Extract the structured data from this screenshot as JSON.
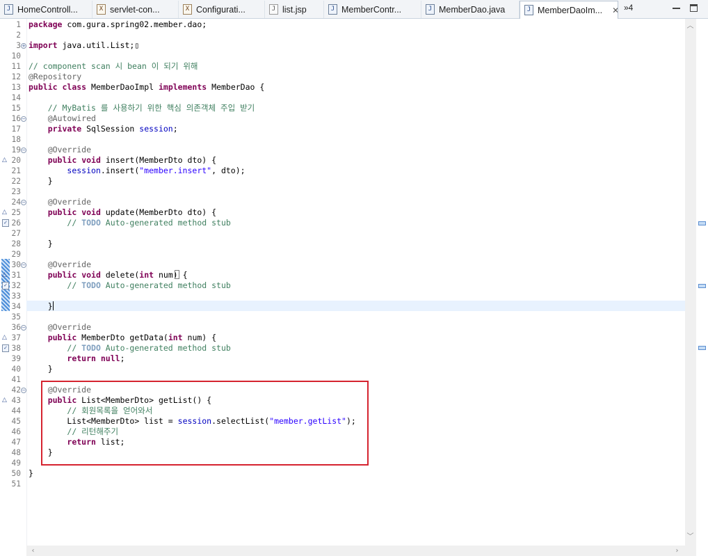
{
  "tabs": [
    {
      "label": "HomeControll...",
      "icon": "java-file-icon",
      "glyph": "J"
    },
    {
      "label": "servlet-con...",
      "icon": "xml-file-icon",
      "glyph": "X"
    },
    {
      "label": "Configurati...",
      "icon": "xml-file-icon",
      "glyph": "X"
    },
    {
      "label": "list.jsp",
      "icon": "jsp-file-icon",
      "glyph": "J"
    },
    {
      "label": "MemberContr...",
      "icon": "java-file-icon",
      "glyph": "J"
    },
    {
      "label": "MemberDao.java",
      "icon": "java-file-icon",
      "glyph": "J"
    },
    {
      "label": "MemberDaoIm...",
      "icon": "java-file-icon",
      "glyph": "J",
      "active": true,
      "close": "✕"
    }
  ],
  "tab_overflow": "»4",
  "editor": {
    "lines": [
      {
        "n": "1",
        "html": "<span class='k'>package</span> com.gura.spring02.member.dao;"
      },
      {
        "n": "2",
        "html": ""
      },
      {
        "n": "3",
        "html": "<span class='k'>import</span> java.util.List;▯",
        "fold": "+"
      },
      {
        "n": "10",
        "html": ""
      },
      {
        "n": "11",
        "html": "<span class='c'>// component scan 시 bean 이 되기 위해</span>"
      },
      {
        "n": "12",
        "html": "<span class='a'>@Repository</span>"
      },
      {
        "n": "13",
        "html": "<span class='k'>public</span> <span class='k'>class</span> MemberDaoImpl <span class='k'>implements</span> MemberDao {"
      },
      {
        "n": "14",
        "html": ""
      },
      {
        "n": "15",
        "html": "    <span class='c'>// MyBatis 를 사용하기 위한 핵심 의존객체 주입 받기</span>"
      },
      {
        "n": "16",
        "html": "    <span class='a'>@Autowired</span>",
        "fold": "-"
      },
      {
        "n": "17",
        "html": "    <span class='k'>private</span> SqlSession <span class='f'>session</span>;"
      },
      {
        "n": "18",
        "html": ""
      },
      {
        "n": "19",
        "html": "    <span class='a'>@Override</span>",
        "fold": "-"
      },
      {
        "n": "20",
        "html": "    <span class='k'>public</span> <span class='k'>void</span> insert(MemberDto dto) {",
        "ov": true
      },
      {
        "n": "21",
        "html": "        <span class='f'>session</span>.insert(<span class='s'>\"member.insert\"</span>, dto);"
      },
      {
        "n": "22",
        "html": "    }"
      },
      {
        "n": "23",
        "html": ""
      },
      {
        "n": "24",
        "html": "    <span class='a'>@Override</span>",
        "fold": "-"
      },
      {
        "n": "25",
        "html": "    <span class='k'>public</span> <span class='k'>void</span> update(MemberDto dto) {",
        "ov": true
      },
      {
        "n": "26",
        "html": "        <span class='c'>// <span class='t'>TODO</span> Auto-generated method stub</span>",
        "task": true
      },
      {
        "n": "27",
        "html": ""
      },
      {
        "n": "28",
        "html": "    }"
      },
      {
        "n": "29",
        "html": ""
      },
      {
        "n": "30",
        "html": "    <span class='a'>@Override</span>",
        "fold": "-"
      },
      {
        "n": "31",
        "html": "    <span class='k'>public</span> <span class='k'>void</span> delete(<span class='k'>int</span> num) {",
        "ov": true
      },
      {
        "n": "32",
        "html": "        <span class='c'>// <span class='t'>TODO</span> Auto-generated method stub</span>",
        "task": true
      },
      {
        "n": "33",
        "html": ""
      },
      {
        "n": "34",
        "html": "    }",
        "current": true
      },
      {
        "n": "35",
        "html": ""
      },
      {
        "n": "36",
        "html": "    <span class='a'>@Override</span>",
        "fold": "-"
      },
      {
        "n": "37",
        "html": "    <span class='k'>public</span> MemberDto getData(<span class='k'>int</span> num) {",
        "ov": true
      },
      {
        "n": "38",
        "html": "        <span class='c'>// <span class='t'>TODO</span> Auto-generated method stub</span>",
        "task": true
      },
      {
        "n": "39",
        "html": "        <span class='k'>return</span> <span class='k'>null</span>;"
      },
      {
        "n": "40",
        "html": "    }"
      },
      {
        "n": "41",
        "html": ""
      },
      {
        "n": "42",
        "html": "    <span class='a'>@Override</span>",
        "fold": "-"
      },
      {
        "n": "43",
        "html": "    <span class='k'>public</span> List&lt;MemberDto&gt; getList() {",
        "ov": true
      },
      {
        "n": "44",
        "html": "        <span class='c'>// 회원목록을 얻어와서</span>"
      },
      {
        "n": "45",
        "html": "        List&lt;MemberDto&gt; list = <span class='f'>session</span>.selectList(<span class='s'>\"member.getList\"</span>);"
      },
      {
        "n": "46",
        "html": "        <span class='c'>// 리턴해주기</span>"
      },
      {
        "n": "47",
        "html": "        <span class='k'>return</span> list;"
      },
      {
        "n": "48",
        "html": "    }"
      },
      {
        "n": "49",
        "html": ""
      },
      {
        "n": "50",
        "html": "}"
      },
      {
        "n": "51",
        "html": ""
      }
    ]
  },
  "colors": {
    "keyword": "#7f0055",
    "comment": "#3f7f5f",
    "string": "#2a00ff",
    "field": "#0000c0",
    "highlight_box": "#d5232f"
  }
}
